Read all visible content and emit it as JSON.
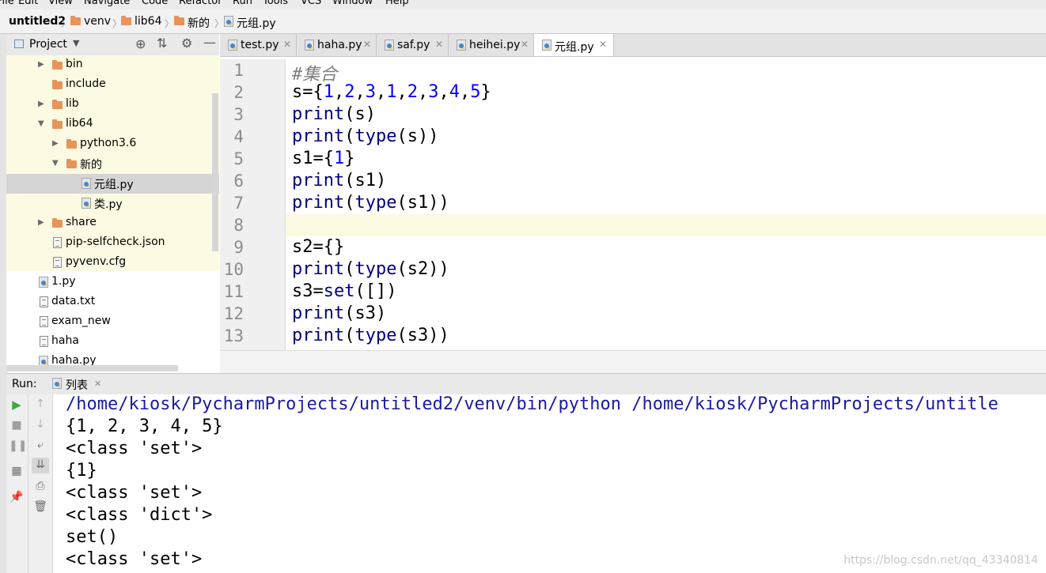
{
  "menu": [
    "File",
    "Edit",
    "View",
    "Navigate",
    "Code",
    "Refactor",
    "Run",
    "Tools",
    "VCS",
    "Window",
    "Help"
  ],
  "breadcrumb": [
    "untitled2",
    "venv",
    "lib64",
    "新的",
    "元组.py"
  ],
  "project_panel": {
    "title": "Project",
    "tree": [
      {
        "label": "bin",
        "kind": "folder",
        "expanded": false
      },
      {
        "label": "include",
        "kind": "folder",
        "expanded": null
      },
      {
        "label": "lib",
        "kind": "folder",
        "expanded": false
      },
      {
        "label": "lib64",
        "kind": "folder",
        "expanded": true
      },
      {
        "label": "python3.6",
        "kind": "folder",
        "expanded": false
      },
      {
        "label": "新的",
        "kind": "folder",
        "expanded": true
      },
      {
        "label": "元组.py",
        "kind": "py",
        "selected": true
      },
      {
        "label": "类.py",
        "kind": "py"
      },
      {
        "label": "share",
        "kind": "folder",
        "expanded": false
      },
      {
        "label": "pip-selfcheck.json",
        "kind": "json"
      },
      {
        "label": "pyvenv.cfg",
        "kind": "file"
      },
      {
        "label": "1.py",
        "kind": "py"
      },
      {
        "label": "data.txt",
        "kind": "file"
      },
      {
        "label": "exam_new",
        "kind": "file"
      },
      {
        "label": "haha",
        "kind": "file"
      },
      {
        "label": "haha.py",
        "kind": "py"
      }
    ]
  },
  "tabs": [
    {
      "label": "test.py",
      "active": false
    },
    {
      "label": "haha.py",
      "active": false
    },
    {
      "label": "saf.py",
      "active": false
    },
    {
      "label": "heihei.py",
      "active": false
    },
    {
      "label": "元组.py",
      "active": true
    }
  ],
  "editor": {
    "current_line": 8,
    "line_numbers": [
      "1",
      "2",
      "3",
      "4",
      "5",
      "6",
      "7",
      "8",
      "9",
      "10",
      "11",
      "12",
      "13"
    ],
    "lines": [
      "#集合",
      "s={1,2,3,1,2,3,4,5}",
      "print(s)",
      "print(type(s))",
      "s1={1}",
      "print(s1)",
      "print(type(s1))",
      "",
      "s2={}",
      "print(type(s2))",
      "s3=set([])",
      "print(s3)",
      "print(type(s3))"
    ]
  },
  "run_panel": {
    "label": "Run:",
    "tab_label": "列表",
    "output": [
      "/home/kiosk/PycharmProjects/untitled2/venv/bin/python /home/kiosk/PycharmProjects/untitle",
      "{1, 2, 3, 4, 5}",
      "<class 'set'>",
      "{1}",
      "<class 'set'>",
      "<class 'dict'>",
      "set()",
      "<class 'set'>"
    ]
  },
  "watermark": "https://blog.csdn.net/qq_43340814",
  "colors": {
    "keyword": "#000080",
    "number": "#0000ff",
    "comment": "#808080",
    "folder": "#e8935a",
    "path": "#1a1aa0"
  }
}
